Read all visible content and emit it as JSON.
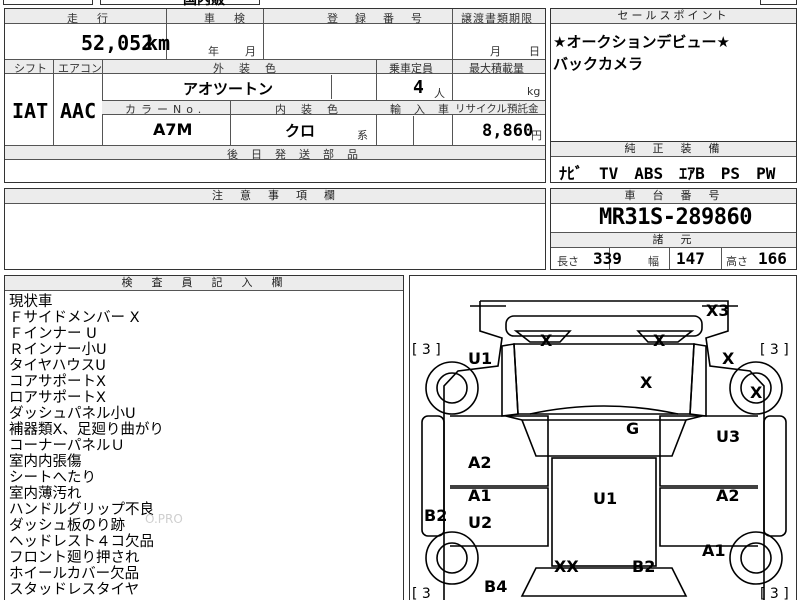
{
  "top_strip": {
    "clipped_text": "国内販"
  },
  "headers": {
    "mileage": "走　行",
    "inspection": "車　検",
    "registration": "登　録　番　号",
    "transfer_date": "譲渡書類期限",
    "sales_point": "セールスポイント",
    "shift": "シフト",
    "ac": "エアコン",
    "exterior_color": "外　装　色",
    "capacity": "乗車定員",
    "max_load": "最大積載量",
    "color_no": "カラーNo.",
    "interior_color": "内　装　色",
    "import": "輸　入　車",
    "recycle_fee": "リサイクル預託金",
    "later_parts": "後　日　発　送　部　品",
    "standard_equipment": "純　正　装　備",
    "notes": "注　意　事　項　欄",
    "chassis_no": "車　台　番　号",
    "specs": "諸　元",
    "inspector_notes": "検　査　員　記　入　欄"
  },
  "values": {
    "mileage": "52,052",
    "mileage_unit": "km",
    "inspection_year_unit": "年",
    "inspection_month_unit": "月",
    "transfer_month_unit": "月",
    "transfer_day_unit": "日",
    "shift": "IAT",
    "ac": "AAC",
    "exterior_color": "アオツートン",
    "capacity": "4",
    "capacity_unit": "人",
    "max_load_unit": "kg",
    "color_no": "A7M",
    "interior_color": "クロ",
    "interior_suffix": "系",
    "recycle_fee": "8,860",
    "recycle_unit": "円",
    "standard_equipment": "ﾅﾋﾞ　TV　ABS　ｴｱB　PS　PW",
    "chassis_no": "MR31S-289860",
    "length_label": "長さ",
    "length": "339",
    "width_label": "幅",
    "width": "147",
    "height_label": "高さ",
    "height": "166"
  },
  "sales_points": [
    "★オークションデビュー★",
    "バックカメラ"
  ],
  "inspector_notes": [
    "現状車",
    "Ｆサイドメンバー X",
    "Ｆインナー U",
    "Ｒインナー小U",
    "タイヤハウスU",
    "コアサポートX",
    "ロアサポートX",
    "ダッシュパネル小U",
    "補器類X、足廻り曲がり",
    "コーナーパネルＵ",
    "室内内張傷",
    "シートへたり",
    "室内薄汚れ",
    "ハンドルグリップ不良",
    "ダッシュ板のり跡",
    "ヘッドレスト４コ欠品",
    "フロント廻り押され",
    "ホイールカバー欠品",
    "スタッドレスタイヤ"
  ],
  "watermark": "O.PRO",
  "diagram_marks": {
    "x3": "X3",
    "fl_x": "X",
    "fr_x": "X",
    "hood_x": "X",
    "r_arch_x": "X",
    "r_wheel_x": "X",
    "u1_left": "U1",
    "u1_center": "U1",
    "g": "G",
    "u3": "U3",
    "a2_left": "A2",
    "a1_left": "A1",
    "u2": "U2",
    "a2_right": "A2",
    "b2_left": "B2",
    "a1_right": "A1",
    "xx": "XX",
    "b2_rear": "B2",
    "b4": "B4",
    "tire_tl": "[ 3 ]",
    "tire_tr": "[ 3 ]",
    "tire_bl": "[ 3",
    "tire_br": "[ 3 ]"
  }
}
